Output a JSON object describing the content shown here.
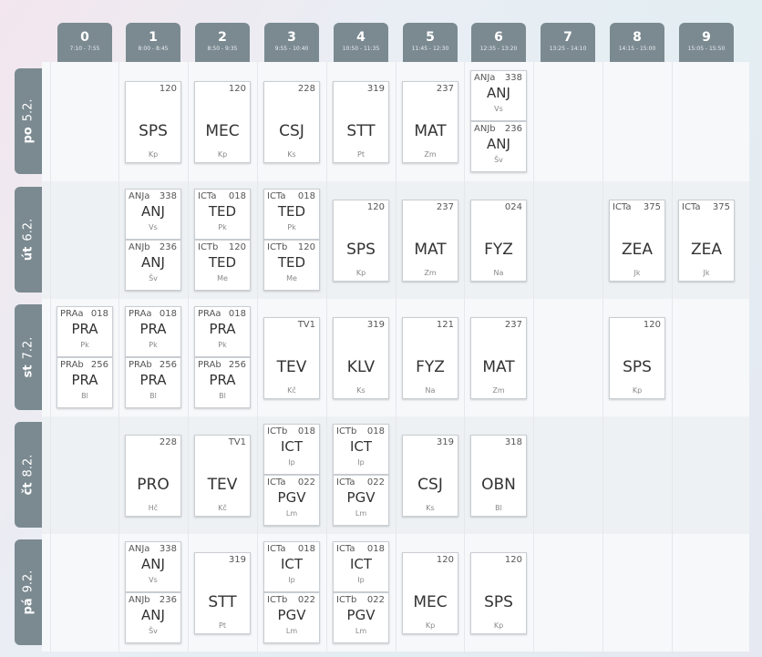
{
  "periods": [
    {
      "num": "0",
      "time": "7:10 - 7:55"
    },
    {
      "num": "1",
      "time": "8:00 - 8:45"
    },
    {
      "num": "2",
      "time": "8:50 - 9:35"
    },
    {
      "num": "3",
      "time": "9:55 - 10:40"
    },
    {
      "num": "4",
      "time": "10:50 - 11:35"
    },
    {
      "num": "5",
      "time": "11:45 - 12:30"
    },
    {
      "num": "6",
      "time": "12:35 - 13:20"
    },
    {
      "num": "7",
      "time": "13:25 - 14:10"
    },
    {
      "num": "8",
      "time": "14:15 - 15:00"
    },
    {
      "num": "9",
      "time": "15:05 - 15:50"
    }
  ],
  "days": [
    {
      "abbr": "po",
      "date": "5.2."
    },
    {
      "abbr": "út",
      "date": "6.2."
    },
    {
      "abbr": "st",
      "date": "7.2."
    },
    {
      "abbr": "čt",
      "date": "8.2."
    },
    {
      "abbr": "pá",
      "date": "9.2."
    }
  ],
  "lessons": [
    {
      "day": 0,
      "period": 1,
      "slot": "full",
      "subject": "SPS",
      "room": "120",
      "teacher": "Kp",
      "group": ""
    },
    {
      "day": 0,
      "period": 2,
      "slot": "full",
      "subject": "MEC",
      "room": "120",
      "teacher": "Kp",
      "group": ""
    },
    {
      "day": 0,
      "period": 3,
      "slot": "full",
      "subject": "CSJ",
      "room": "228",
      "teacher": "Ks",
      "group": ""
    },
    {
      "day": 0,
      "period": 4,
      "slot": "full",
      "subject": "STT",
      "room": "319",
      "teacher": "Pt",
      "group": ""
    },
    {
      "day": 0,
      "period": 5,
      "slot": "full",
      "subject": "MAT",
      "room": "237",
      "teacher": "Zm",
      "group": ""
    },
    {
      "day": 0,
      "period": 6,
      "slot": "top",
      "subject": "ANJ",
      "room": "338",
      "teacher": "Vs",
      "group": "ANJa"
    },
    {
      "day": 0,
      "period": 6,
      "slot": "bottom",
      "subject": "ANJ",
      "room": "236",
      "teacher": "Šv",
      "group": "ANJb"
    },
    {
      "day": 1,
      "period": 1,
      "slot": "top",
      "subject": "ANJ",
      "room": "338",
      "teacher": "Vs",
      "group": "ANJa"
    },
    {
      "day": 1,
      "period": 1,
      "slot": "bottom",
      "subject": "ANJ",
      "room": "236",
      "teacher": "Šv",
      "group": "ANJb"
    },
    {
      "day": 1,
      "period": 2,
      "slot": "top",
      "subject": "TED",
      "room": "018",
      "teacher": "Pk",
      "group": "ICTa"
    },
    {
      "day": 1,
      "period": 2,
      "slot": "bottom",
      "subject": "TED",
      "room": "120",
      "teacher": "Me",
      "group": "ICTb"
    },
    {
      "day": 1,
      "period": 3,
      "slot": "top",
      "subject": "TED",
      "room": "018",
      "teacher": "Pk",
      "group": "ICTa"
    },
    {
      "day": 1,
      "period": 3,
      "slot": "bottom",
      "subject": "TED",
      "room": "120",
      "teacher": "Me",
      "group": "ICTb"
    },
    {
      "day": 1,
      "period": 4,
      "slot": "full",
      "subject": "SPS",
      "room": "120",
      "teacher": "Kp",
      "group": ""
    },
    {
      "day": 1,
      "period": 5,
      "slot": "full",
      "subject": "MAT",
      "room": "237",
      "teacher": "Zm",
      "group": ""
    },
    {
      "day": 1,
      "period": 6,
      "slot": "full",
      "subject": "FYZ",
      "room": "024",
      "teacher": "Na",
      "group": ""
    },
    {
      "day": 1,
      "period": 8,
      "slot": "full",
      "subject": "ZEA",
      "room": "375",
      "teacher": "Jk",
      "group": "ICTa"
    },
    {
      "day": 1,
      "period": 9,
      "slot": "full",
      "subject": "ZEA",
      "room": "375",
      "teacher": "Jk",
      "group": "ICTa"
    },
    {
      "day": 2,
      "period": 0,
      "slot": "top",
      "subject": "PRA",
      "room": "018",
      "teacher": "Pk",
      "group": "PRAa"
    },
    {
      "day": 2,
      "period": 0,
      "slot": "bottom",
      "subject": "PRA",
      "room": "256",
      "teacher": "Bl",
      "group": "PRAb"
    },
    {
      "day": 2,
      "period": 1,
      "slot": "top",
      "subject": "PRA",
      "room": "018",
      "teacher": "Pk",
      "group": "PRAa"
    },
    {
      "day": 2,
      "period": 1,
      "slot": "bottom",
      "subject": "PRA",
      "room": "256",
      "teacher": "Bl",
      "group": "PRAb"
    },
    {
      "day": 2,
      "period": 2,
      "slot": "top",
      "subject": "PRA",
      "room": "018",
      "teacher": "Pk",
      "group": "PRAa"
    },
    {
      "day": 2,
      "period": 2,
      "slot": "bottom",
      "subject": "PRA",
      "room": "256",
      "teacher": "Bl",
      "group": "PRAb"
    },
    {
      "day": 2,
      "period": 3,
      "slot": "full",
      "subject": "TEV",
      "room": "TV1",
      "teacher": "Kč",
      "group": ""
    },
    {
      "day": 2,
      "period": 4,
      "slot": "full",
      "subject": "KLV",
      "room": "319",
      "teacher": "Ks",
      "group": ""
    },
    {
      "day": 2,
      "period": 5,
      "slot": "full",
      "subject": "FYZ",
      "room": "121",
      "teacher": "Na",
      "group": ""
    },
    {
      "day": 2,
      "period": 6,
      "slot": "full",
      "subject": "MAT",
      "room": "237",
      "teacher": "Zm",
      "group": ""
    },
    {
      "day": 2,
      "period": 8,
      "slot": "full",
      "subject": "SPS",
      "room": "120",
      "teacher": "Kp",
      "group": ""
    },
    {
      "day": 3,
      "period": 1,
      "slot": "full",
      "subject": "PRO",
      "room": "228",
      "teacher": "Hč",
      "group": ""
    },
    {
      "day": 3,
      "period": 2,
      "slot": "full",
      "subject": "TEV",
      "room": "TV1",
      "teacher": "Kč",
      "group": ""
    },
    {
      "day": 3,
      "period": 3,
      "slot": "top",
      "subject": "ICT",
      "room": "018",
      "teacher": "Ip",
      "group": "ICTb"
    },
    {
      "day": 3,
      "period": 3,
      "slot": "bottom",
      "subject": "PGV",
      "room": "022",
      "teacher": "Lm",
      "group": "ICTa"
    },
    {
      "day": 3,
      "period": 4,
      "slot": "top",
      "subject": "ICT",
      "room": "018",
      "teacher": "Ip",
      "group": "ICTb"
    },
    {
      "day": 3,
      "period": 4,
      "slot": "bottom",
      "subject": "PGV",
      "room": "022",
      "teacher": "Lm",
      "group": "ICTa"
    },
    {
      "day": 3,
      "period": 5,
      "slot": "full",
      "subject": "CSJ",
      "room": "319",
      "teacher": "Ks",
      "group": ""
    },
    {
      "day": 3,
      "period": 6,
      "slot": "full",
      "subject": "OBN",
      "room": "318",
      "teacher": "Bl",
      "group": ""
    },
    {
      "day": 4,
      "period": 1,
      "slot": "top",
      "subject": "ANJ",
      "room": "338",
      "teacher": "Vs",
      "group": "ANJa"
    },
    {
      "day": 4,
      "period": 1,
      "slot": "bottom",
      "subject": "ANJ",
      "room": "236",
      "teacher": "Šv",
      "group": "ANJb"
    },
    {
      "day": 4,
      "period": 2,
      "slot": "full",
      "subject": "STT",
      "room": "319",
      "teacher": "Pt",
      "group": ""
    },
    {
      "day": 4,
      "period": 3,
      "slot": "top",
      "subject": "ICT",
      "room": "018",
      "teacher": "Ip",
      "group": "ICTa"
    },
    {
      "day": 4,
      "period": 3,
      "slot": "bottom",
      "subject": "PGV",
      "room": "022",
      "teacher": "Lm",
      "group": "ICTb"
    },
    {
      "day": 4,
      "period": 4,
      "slot": "top",
      "subject": "ICT",
      "room": "018",
      "teacher": "Ip",
      "group": "ICTa"
    },
    {
      "day": 4,
      "period": 4,
      "slot": "bottom",
      "subject": "PGV",
      "room": "022",
      "teacher": "Lm",
      "group": "ICTb"
    },
    {
      "day": 4,
      "period": 5,
      "slot": "full",
      "subject": "MEC",
      "room": "120",
      "teacher": "Kp",
      "group": ""
    },
    {
      "day": 4,
      "period": 6,
      "slot": "full",
      "subject": "SPS",
      "room": "120",
      "teacher": "Kp",
      "group": ""
    }
  ]
}
